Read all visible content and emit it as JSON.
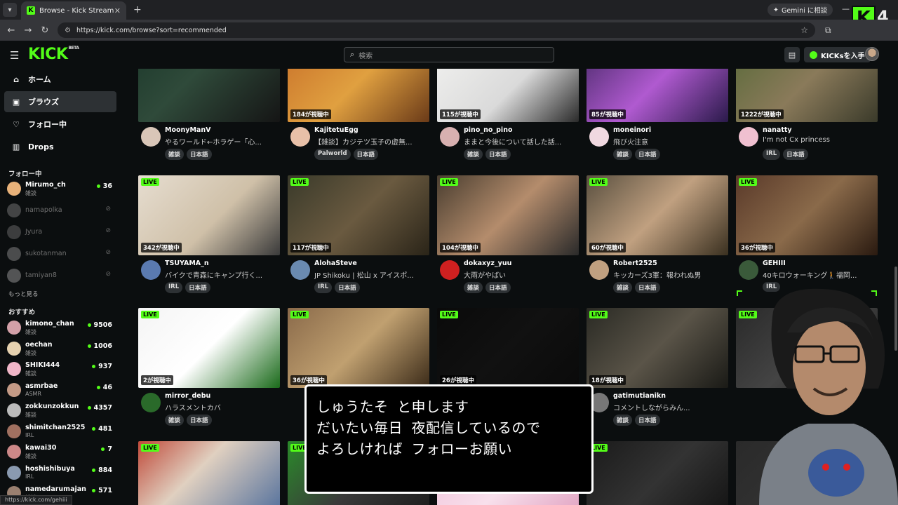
{
  "browser": {
    "tab_title": "Browse - Kick Streaming",
    "url": "https://kick.com/browse?sort=recommended",
    "gemini_label": "Gemini に相談",
    "status_url": "https://kick.com/gehiii",
    "brand_number": "4"
  },
  "header": {
    "logo_text": "KICK",
    "logo_beta": "BETA",
    "search_placeholder": "検索",
    "kicks_button": "KICKsを入手"
  },
  "sidebar": {
    "nav": [
      {
        "label": "ホーム",
        "icon": "home-icon"
      },
      {
        "label": "ブラウズ",
        "icon": "browse-icon"
      },
      {
        "label": "フォロー中",
        "icon": "heart-icon"
      },
      {
        "label": "Drops",
        "icon": "drops-icon"
      }
    ],
    "following_title": "フォロー中",
    "following": [
      {
        "name": "Mirumo_ch",
        "category": "雑談",
        "viewers": "36",
        "live": true,
        "color": "#e8b27a"
      },
      {
        "name": "namapolka",
        "live": false,
        "color": "#888"
      },
      {
        "name": "Jyura",
        "live": false,
        "color": "#777"
      },
      {
        "name": "sukotanman",
        "live": false,
        "color": "#999"
      },
      {
        "name": "tamiyan8",
        "live": false,
        "color": "#aaa"
      }
    ],
    "more_label": "もっと見る",
    "recommended_title": "おすすめ",
    "recommended": [
      {
        "name": "kimono_chan",
        "category": "雑談",
        "viewers": "9506",
        "color": "#d3a0a8"
      },
      {
        "name": "oechan",
        "category": "雑談",
        "viewers": "1006",
        "color": "#e6d2b0"
      },
      {
        "name": "SHIKI444",
        "category": "雑談",
        "viewers": "937",
        "color": "#f0b6c8"
      },
      {
        "name": "asmrbae",
        "category": "ASMR",
        "viewers": "46",
        "color": "#c49a86"
      },
      {
        "name": "zokkunzokkun",
        "category": "雑談",
        "viewers": "4357",
        "color": "#bbbbbb"
      },
      {
        "name": "shimitchan2525",
        "category": "IRL",
        "viewers": "481",
        "color": "#a07060"
      },
      {
        "name": "kawai30",
        "category": "雑談",
        "viewers": "7",
        "color": "#c88"
      },
      {
        "name": "hoshishibuya",
        "category": "IRL",
        "viewers": "884",
        "color": "#8a9ab0"
      },
      {
        "name": "namedarumajan",
        "category": "雑談",
        "viewers": "571",
        "color": "#9a8070"
      }
    ]
  },
  "grid": {
    "live_label": "LIVE",
    "rows": [
      [
        {
          "viewers": "",
          "name": "MoonyManV",
          "title": "やるワールド←ホラゲー「心...",
          "tags": [
            "雑談",
            "日本語"
          ],
          "thumb": "linear-gradient(135deg,#1e3a2c,#2f4a3a 40%,#151515)",
          "av": "#d9c6b8",
          "live": false
        },
        {
          "viewers": "184が視聴中",
          "name": "KajitetuEgg",
          "title": "【雑談】カジテツ玉子の虚無...",
          "tags": [
            "Palworld",
            "日本語"
          ],
          "thumb": "linear-gradient(135deg,#c9722a,#e0a040 50%,#6a3a18)",
          "av": "#e8c0a8",
          "live": false
        },
        {
          "viewers": "115が視聴中",
          "name": "pino_no_pino",
          "title": "ままと今後について話した話...",
          "tags": [
            "雑談",
            "日本語"
          ],
          "thumb": "linear-gradient(135deg,#f2f2f0,#dadada 55%,#2a2a2a)",
          "av": "#d8b0b0",
          "live": false
        },
        {
          "viewers": "85が視聴中",
          "name": "moneinori",
          "title": "飛び火注意",
          "tags": [
            "雑談",
            "日本語"
          ],
          "thumb": "linear-gradient(135deg,#4a2a6a,#b05ad0 50%,#2a1a4a)",
          "av": "#f0d8e0",
          "live": false
        },
        {
          "viewers": "1222が視聴中",
          "name": "nanatty",
          "title": "I'm not Cx princess",
          "tags": [
            "IRL",
            "日本語"
          ],
          "thumb": "linear-gradient(135deg,#5a6a3a,#8a7a5a 50%,#3a3a2a)",
          "av": "#f0c0d0",
          "live": false
        }
      ],
      [
        {
          "viewers": "342が視聴中",
          "name": "TSUYAMA_n",
          "title": "バイクで青森にキャンプ行く...",
          "tags": [
            "IRL",
            "日本語"
          ],
          "thumb": "linear-gradient(135deg,#e6ddd0,#cfc0a8 55%,#3a3a3a)",
          "av": "#5a7ab0",
          "live": true
        },
        {
          "viewers": "117が視聴中",
          "name": "AlohaSteve",
          "title": "JP Shikoku | 松山 x アイスポ...",
          "tags": [
            "IRL",
            "日本語"
          ],
          "thumb": "linear-gradient(135deg,#3a3a2a,#6a5a40 50%,#2a2418)",
          "av": "#6a8ab0",
          "live": true
        },
        {
          "viewers": "104が視聴中",
          "name": "dokaxyz_yuu",
          "title": "大雨がやばい",
          "tags": [
            "雑談",
            "日本語"
          ],
          "thumb": "linear-gradient(135deg,#4a3e30,#b48c6c 50%,#2a2a2a)",
          "av": "#d02020",
          "live": true
        },
        {
          "viewers": "60が視聴中",
          "name": "Robert2525",
          "title": "キッカーズ3軍：報われぬ男",
          "tags": [
            "雑談",
            "日本語"
          ],
          "thumb": "linear-gradient(135deg,#5a5040,#c0a080 50%,#3a3020)",
          "av": "#c0a080",
          "live": true
        },
        {
          "viewers": "36が視聴中",
          "name": "GEHIII",
          "title": "40キロウォーキング🚶福岡...",
          "tags": [
            "IRL"
          ],
          "thumb": "linear-gradient(135deg,#5a3a2a,#8a6a4a 50%,#2a1a10)",
          "av": "#3a5a3a",
          "live": true
        }
      ],
      [
        {
          "viewers": "2が視聴中",
          "name": "mirror_debu",
          "title": "ハラスメントカバ",
          "tags": [
            "雑談",
            "日本語"
          ],
          "thumb": "linear-gradient(135deg,#f4f4f4,#ffffff 50%,#1a6a1a)",
          "av": "#2a6a2a",
          "live": true
        },
        {
          "viewers": "36が視聴中",
          "name": "",
          "title": "",
          "tags": [],
          "thumb": "linear-gradient(135deg,#8a6a4a,#c0a070 50%,#3a2a18)",
          "av": "#e0c070",
          "live": true
        },
        {
          "viewers": "26が視聴中",
          "name": "",
          "title": "",
          "tags": [],
          "thumb": "linear-gradient(135deg,#0a0a0a,#111 50%,#0a0a0a)",
          "av": "#333",
          "live": true
        },
        {
          "viewers": "18が視聴中",
          "name": "gatimutianikn",
          "title": "コメントしながらみん...",
          "tags": [
            "雑談",
            "日本語"
          ],
          "thumb": "linear-gradient(135deg,#2a2a24,#5a5448 50%,#1a1a16)",
          "av": "#777",
          "live": true
        },
        {
          "viewers": "",
          "name": "",
          "title": "",
          "tags": [],
          "thumb": "linear-gradient(135deg,#2a2a2a,#444 50%,#1a1a1a)",
          "av": "#555",
          "live": true
        }
      ],
      [
        {
          "viewers": "",
          "name": "",
          "title": "",
          "tags": [],
          "thumb": "linear-gradient(135deg,#c04a3a,#e0d0c0 40%,#4a6a9a)",
          "av": "#777",
          "live": true
        },
        {
          "viewers": "",
          "name": "",
          "title": "",
          "tags": [],
          "thumb": "linear-gradient(135deg,#2a8a2a,#3a3a3a 50%,#1a1a1a)",
          "av": "#777",
          "live": true
        },
        {
          "viewers": "",
          "name": "",
          "title": "",
          "tags": [],
          "thumb": "linear-gradient(135deg,#f0c0d8,#f8e0ec 50%,#e0a0c0)",
          "av": "#777",
          "live": false
        },
        {
          "viewers": "",
          "name": "",
          "title": "",
          "tags": [],
          "thumb": "linear-gradient(135deg,#1a1a1a,#333 50%,#111)",
          "av": "#777",
          "live": true
        },
        {
          "viewers": "",
          "name": "",
          "title": "",
          "tags": [],
          "thumb": "linear-gradient(135deg,#2a2a2a,#3a3a3a)",
          "av": "#777",
          "live": false
        }
      ]
    ]
  },
  "overlay": {
    "dialog_lines": [
      "しゅうたそ と申します",
      "だいたい毎日 夜配信しているので",
      "よろしければ フォローお願い"
    ]
  }
}
